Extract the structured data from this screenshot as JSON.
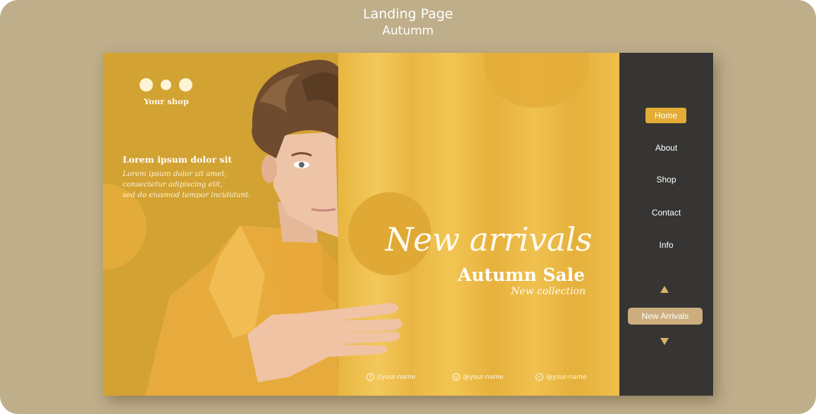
{
  "header": {
    "title": "Landing Page",
    "subtitle": "Autumm"
  },
  "brand": {
    "name": "Your shop"
  },
  "intro": {
    "title": "Lorem ipsum dolor sit",
    "lines": [
      "Lorem ipsum dolor sit amet,",
      "consectetur adipiscing elit,",
      "sed do eiusmod tempor incididunt."
    ]
  },
  "promo": {
    "headline": "New arrivals",
    "sale": "Autumn Sale",
    "subline": "New collection"
  },
  "social": [
    {
      "icon": "facebook-icon",
      "glyph": "f",
      "handle": "//your-name"
    },
    {
      "icon": "instagram-icon",
      "glyph": "◎",
      "handle": "@your-name"
    },
    {
      "icon": "twitter-icon",
      "glyph": "✓",
      "handle": "@your-name"
    }
  ],
  "nav": {
    "items": [
      "Home",
      "About",
      "Shop",
      "Contact",
      "Info"
    ],
    "active": "Home",
    "cta_label": "New Arrivals"
  },
  "colors": {
    "frame": "#bfae8a",
    "accent": "#e3ad35",
    "hero": "#d2a233",
    "sidebar": "#363533",
    "cta": "#ccae7e"
  }
}
